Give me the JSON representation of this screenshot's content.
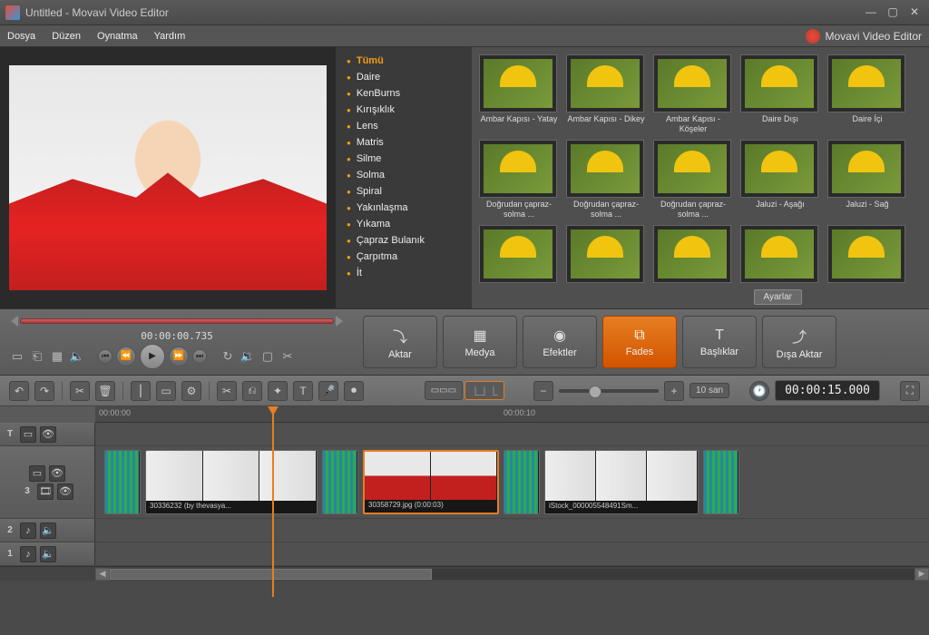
{
  "window": {
    "title": "Untitled - Movavi Video Editor"
  },
  "brand": "Movavi Video Editor",
  "menu": {
    "file": "Dosya",
    "edit": "Düzen",
    "play": "Oynatma",
    "help": "Yardım"
  },
  "categories": {
    "items": [
      {
        "label": "Tümü",
        "active": true
      },
      {
        "label": "Daire"
      },
      {
        "label": "KenBurns"
      },
      {
        "label": "Kırışıklık"
      },
      {
        "label": "Lens"
      },
      {
        "label": "Matris"
      },
      {
        "label": "Silme"
      },
      {
        "label": "Solma"
      },
      {
        "label": "Spiral"
      },
      {
        "label": "Yakınlaşma"
      },
      {
        "label": "Yıkama"
      },
      {
        "label": "Çapraz Bulanık"
      },
      {
        "label": "Çarpıtma"
      },
      {
        "label": "İt"
      }
    ]
  },
  "transitions": {
    "row1": [
      {
        "label": "Ambar Kapısı - Yatay"
      },
      {
        "label": "Ambar Kapısı - Dikey"
      },
      {
        "label": "Ambar Kapısı - Köşeler"
      },
      {
        "label": "Daire Dışı"
      },
      {
        "label": "Daire İçi"
      }
    ],
    "row2": [
      {
        "label": "Doğrudan çapraz-solma ..."
      },
      {
        "label": "Doğrudan çapraz-solma ..."
      },
      {
        "label": "Doğrudan çapraz-solma ..."
      },
      {
        "label": "Jaluzi - Aşağı"
      },
      {
        "label": "Jaluzi - Sağ"
      }
    ],
    "settings_label": "Ayarlar"
  },
  "playback": {
    "timecode": "00:00:00.735"
  },
  "modes": {
    "import": "Aktar",
    "media": "Medya",
    "effects": "Efektler",
    "fades": "Fades",
    "titles": "Başlıklar",
    "export": "Dışa Aktar"
  },
  "toolbar2": {
    "snap_label": "10 san",
    "timecode": "00:00:15.000"
  },
  "ruler": {
    "t0": "00:00:00",
    "t1": "00:00:10"
  },
  "tracks": {
    "t_label": "T",
    "v_num": "3",
    "a2_num": "2",
    "a1_num": "1"
  },
  "clips": [
    {
      "label": "30336232 (by thevasya..."
    },
    {
      "label": "30358729.jpg (0:00:03)"
    },
    {
      "label": "iStock_000005548491Sm..."
    }
  ]
}
